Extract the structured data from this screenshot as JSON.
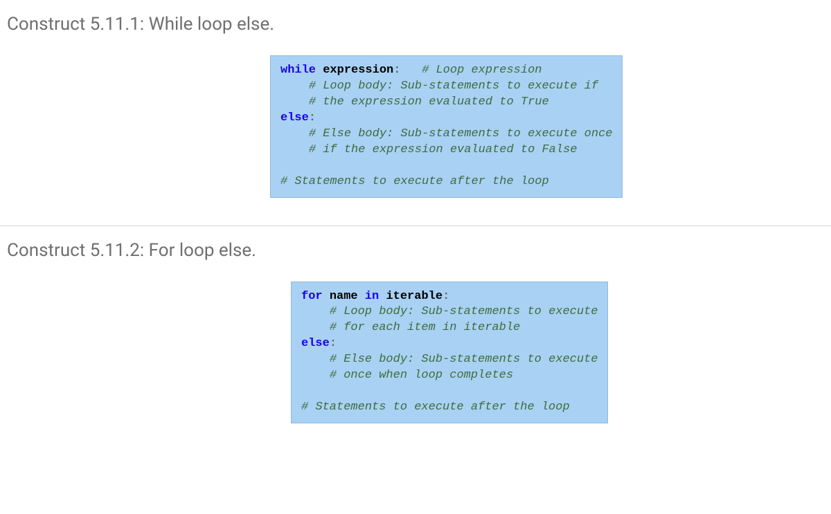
{
  "section1": {
    "heading": "Construct 5.11.1: While loop else.",
    "code": {
      "l1_kw": "while",
      "l1_id": "expression",
      "l1_p": ":",
      "l1_c": "# Loop expression",
      "l2_c": "# Loop body: Sub-statements to execute if",
      "l3_c": "# the expression evaluated to True",
      "l4_kw": "else",
      "l4_p": ":",
      "l5_c": "# Else body: Sub-statements to execute once",
      "l6_c": "# if the expression evaluated to False",
      "l7_c": "# Statements to execute after the loop"
    }
  },
  "section2": {
    "heading": "Construct 5.11.2: For loop else.",
    "code": {
      "l1_kw1": "for",
      "l1_id1": "name",
      "l1_kw2": "in",
      "l1_id2": "iterable",
      "l1_p": ":",
      "l2_c": "# Loop body: Sub-statements to execute",
      "l3_c": "# for each item in iterable",
      "l4_kw": "else",
      "l4_p": ":",
      "l5_c": "# Else body: Sub-statements to execute",
      "l6_c": "# once when loop completes",
      "l7_c": "# Statements to execute after the loop"
    }
  }
}
